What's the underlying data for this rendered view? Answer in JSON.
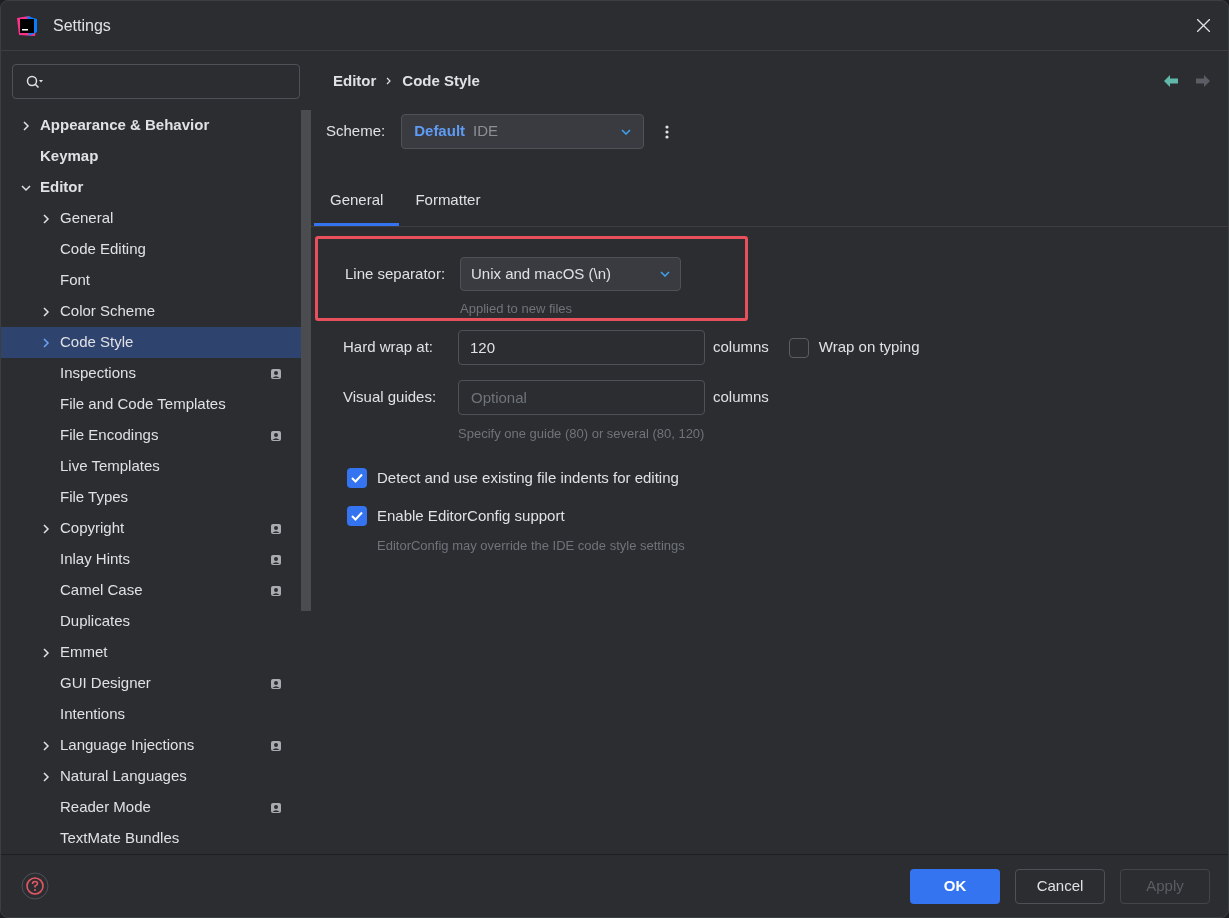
{
  "window": {
    "title": "Settings"
  },
  "sidebar": {
    "items": [
      {
        "label": "Appearance & Behavior",
        "expanded": false,
        "selected": false,
        "badge": false
      },
      {
        "label": "Keymap",
        "selected": false,
        "badge": false
      },
      {
        "label": "Editor",
        "expanded": true,
        "selected": false,
        "badge": false,
        "children": [
          {
            "label": "General",
            "expanded": false,
            "selected": false,
            "badge": false
          },
          {
            "label": "Code Editing",
            "selected": false,
            "badge": false
          },
          {
            "label": "Font",
            "selected": false,
            "badge": false
          },
          {
            "label": "Color Scheme",
            "expanded": false,
            "selected": false,
            "badge": false
          },
          {
            "label": "Code Style",
            "expanded": false,
            "selected": true,
            "badge": false
          },
          {
            "label": "Inspections",
            "selected": false,
            "badge": true
          },
          {
            "label": "File and Code Templates",
            "selected": false,
            "badge": false
          },
          {
            "label": "File Encodings",
            "selected": false,
            "badge": true
          },
          {
            "label": "Live Templates",
            "selected": false,
            "badge": false
          },
          {
            "label": "File Types",
            "selected": false,
            "badge": false
          },
          {
            "label": "Copyright",
            "expanded": false,
            "selected": false,
            "badge": true
          },
          {
            "label": "Inlay Hints",
            "selected": false,
            "badge": true
          },
          {
            "label": "Camel Case",
            "selected": false,
            "badge": true
          },
          {
            "label": "Duplicates",
            "selected": false,
            "badge": false
          },
          {
            "label": "Emmet",
            "expanded": false,
            "selected": false,
            "badge": false
          },
          {
            "label": "GUI Designer",
            "selected": false,
            "badge": true
          },
          {
            "label": "Intentions",
            "selected": false,
            "badge": false
          },
          {
            "label": "Language Injections",
            "expanded": false,
            "selected": false,
            "badge": true
          },
          {
            "label": "Natural Languages",
            "expanded": false,
            "selected": false,
            "badge": false
          },
          {
            "label": "Reader Mode",
            "selected": false,
            "badge": true
          },
          {
            "label": "TextMate Bundles",
            "selected": false,
            "badge": false
          }
        ]
      }
    ]
  },
  "breadcrumb": [
    "Editor",
    "Code Style"
  ],
  "navigation": [
    {
      "kind": "back",
      "disabled": false
    },
    {
      "kind": "forward",
      "disabled": true
    }
  ],
  "scheme": {
    "label": "Scheme:",
    "name": "Default",
    "scope": "IDE"
  },
  "tabs": [
    {
      "label": "General",
      "selected": true
    },
    {
      "label": "Formatter",
      "selected": false
    }
  ],
  "line_separator": {
    "label": "Line separator:",
    "value": "Unix and macOS (\\n)",
    "hint": "Applied to new files",
    "highlighted": true
  },
  "hard_wrap": {
    "label": "Hard wrap at:",
    "value": "120",
    "unit": "columns",
    "wrap_on_typing": {
      "label": "Wrap on typing",
      "checked": false
    }
  },
  "visual_guides": {
    "label": "Visual guides:",
    "placeholder": "Optional",
    "unit": "columns",
    "hint": "Specify one guide (80) or several (80, 120)"
  },
  "options": [
    {
      "label": "Detect and use existing file indents for editing",
      "checked": true
    },
    {
      "label": "Enable EditorConfig support",
      "checked": true,
      "hint": "EditorConfig may override the IDE code style settings"
    }
  ],
  "buttons": [
    {
      "label": "OK",
      "kind": "primary",
      "disabled": false
    },
    {
      "label": "Cancel",
      "kind": "secondary",
      "disabled": false
    },
    {
      "label": "Apply",
      "kind": "secondary",
      "disabled": true
    }
  ]
}
